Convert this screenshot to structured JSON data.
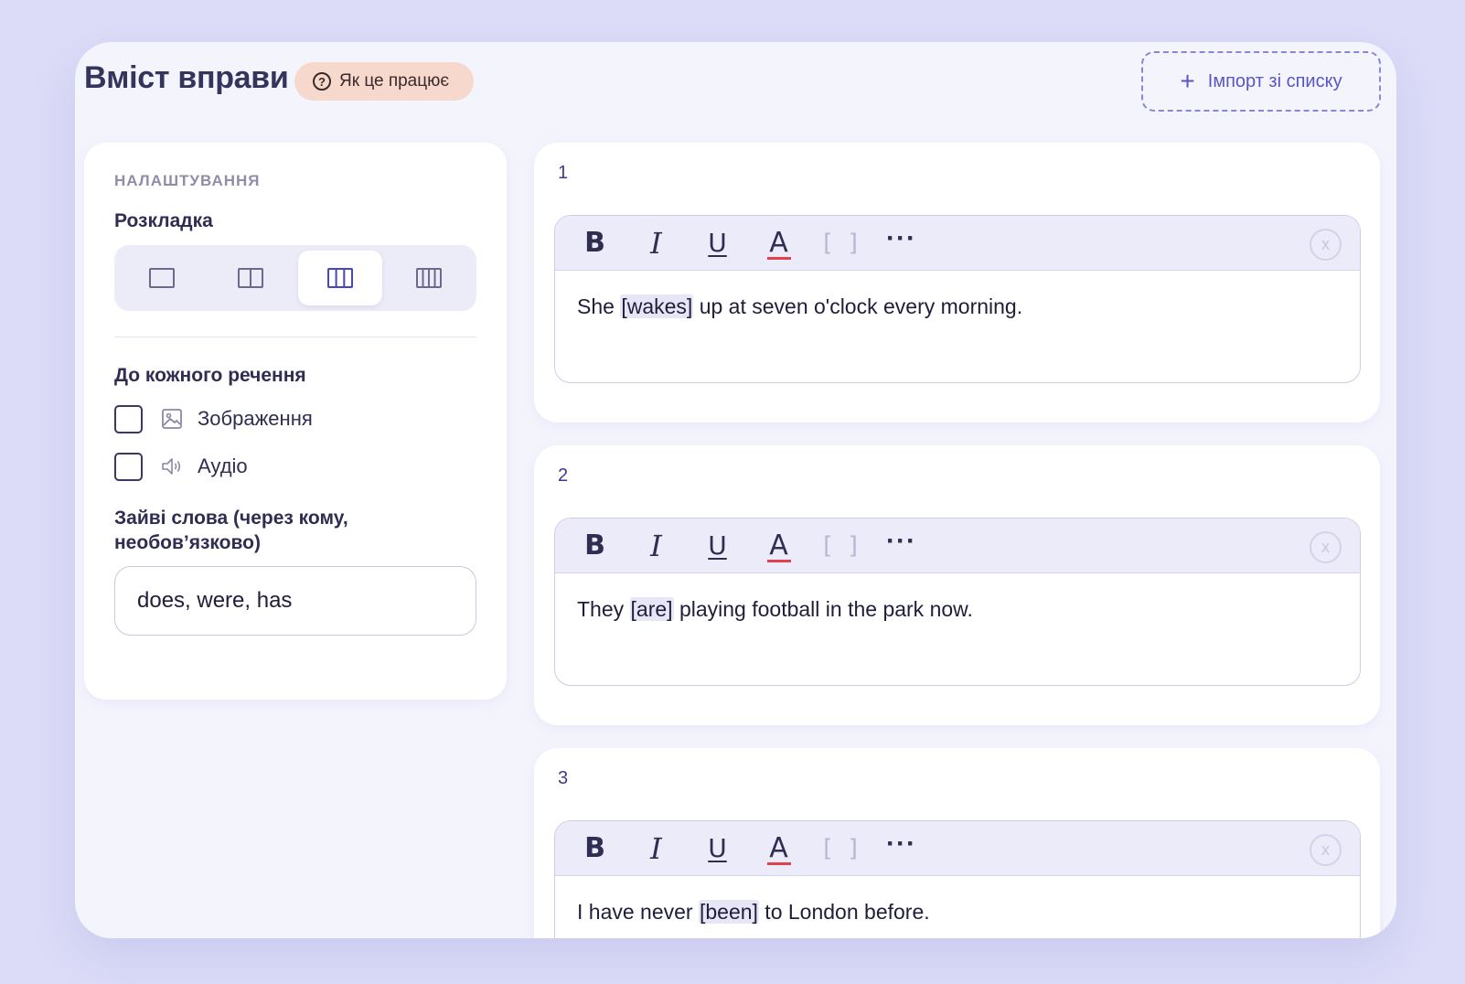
{
  "header": {
    "title": "Вміст вправи",
    "help_label": "Як це працює",
    "import_label": "Імпорт зі списку"
  },
  "settings": {
    "section_title": "НАЛАШТУВАННЯ",
    "layout_label": "Розкладка",
    "layout_options": [
      "1 column",
      "2 columns",
      "3 columns",
      "4 columns"
    ],
    "layout_selected": "3 columns",
    "per_sentence_label": "До кожного речення",
    "options": [
      {
        "label": "Зображення",
        "icon": "image-icon",
        "checked": false
      },
      {
        "label": "Аудіо",
        "icon": "speaker-icon",
        "checked": false
      }
    ],
    "extra_words_label": "Зайві слова (через кому, необов’язково)",
    "extra_words_value": "does, were, has"
  },
  "sentences": [
    {
      "number": "1",
      "before": "She ",
      "gap": "[wakes]",
      "after": " up at seven o'clock every morning."
    },
    {
      "number": "2",
      "before": "They ",
      "gap": "[are]",
      "after": " playing football in the park now."
    },
    {
      "number": "3",
      "before": "I have never ",
      "gap": "[been]",
      "after": " to London before."
    }
  ],
  "toolbar": {
    "bold": "B",
    "italic": "I",
    "underline": "U",
    "color": "A",
    "gap": "[ ]",
    "more": "···",
    "clear": "x"
  },
  "colors": {
    "accent": "#5a55c4",
    "help_pill": "#f6d8cc",
    "text_color_bar": "#e0424c"
  }
}
